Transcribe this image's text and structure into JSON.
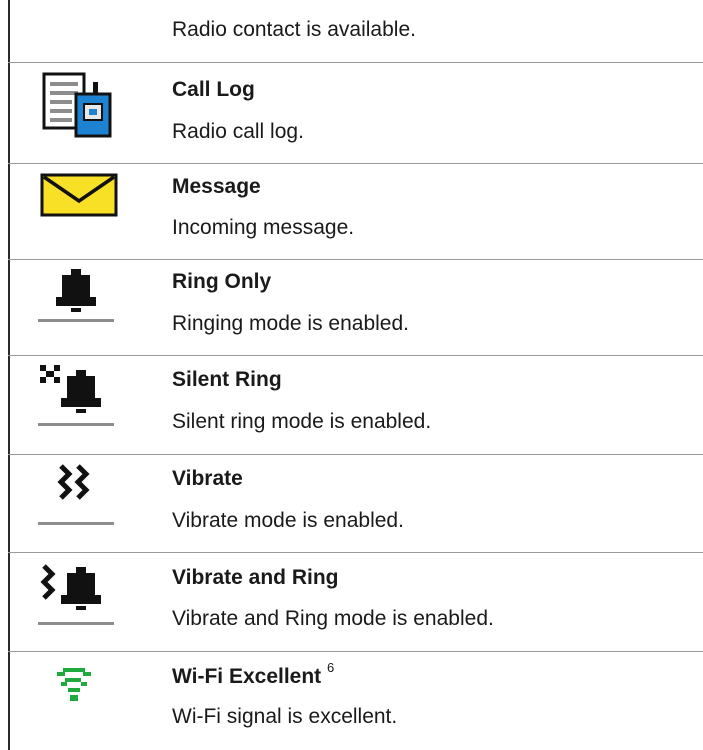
{
  "rows": [
    {
      "description": "Radio contact is available."
    },
    {
      "title": "Call Log",
      "description": "Radio call log.",
      "icon": "call-log-icon"
    },
    {
      "title": "Message",
      "description": "Incoming message.",
      "icon": "message-envelope-icon"
    },
    {
      "title": "Ring Only",
      "description": "Ringing mode is enabled.",
      "icon": "bell-icon"
    },
    {
      "title": "Silent Ring",
      "description": "Silent ring mode is enabled.",
      "icon": "silent-bell-icon"
    },
    {
      "title": "Vibrate",
      "description": "Vibrate mode is enabled.",
      "icon": "vibrate-icon"
    },
    {
      "title": "Vibrate and Ring",
      "description": "Vibrate and Ring mode is enabled.",
      "icon": "vibrate-bell-icon"
    },
    {
      "title": "Wi-Fi Excellent",
      "superscript": "6",
      "description": "Wi-Fi signal is excellent.",
      "icon": "wifi-excellent-icon"
    }
  ],
  "colors": {
    "text": "#1a1a1a",
    "rule": "#9a9a9a",
    "wifi_green": "#1faa3e",
    "envelope_yellow": "#f7e026"
  }
}
